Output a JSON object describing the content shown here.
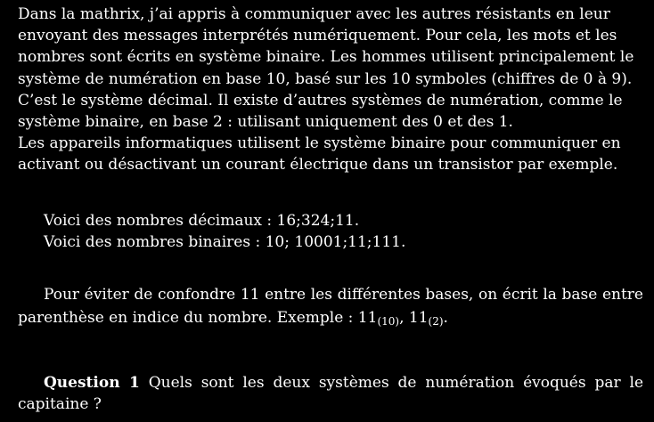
{
  "intro": {
    "line1": "Dans la mathrix, j’ai appris à communiquer avec les autres résistants en leur",
    "line2": "envoyant des messages interprétés numériquement.  Pour cela, les mots et les",
    "line3": "nombres sont écrits en système binaire. Les hommes utilisent principalement le",
    "line4": "système de numération en base 10, basé sur les 10 symboles (chiffres de 0 à 9).",
    "line5": "C’est le système décimal.  Il existe d’autres systèmes de numération, comme le",
    "line6": "système binaire, en base 2 :  utilisant uniquement des 0 et des 1.",
    "line7": "Les appareils informatiques utilisent le système binaire pour communiquer en",
    "line8": "activant ou désactivant un courant électrique dans un transistor par exemple."
  },
  "examples": {
    "decimal": "Voici des nombres décimaux :  16;324;11.",
    "binary": "Voici des nombres binaires :  10; 10001;11;111."
  },
  "bases": {
    "text": "Pour éviter de confondre 11 entre les différentes bases, on écrit la base entre parenthèse en indice du nombre. Exemple : ",
    "ex1_number": "11",
    "ex1_base": "(10)",
    "separator": ", ",
    "ex2_number": "11",
    "ex2_base": "(2)",
    "end": "."
  },
  "question": {
    "label": "Question 1",
    "text": " Quels sont les deux systèmes de numération évoqués par le capitaine ?"
  }
}
